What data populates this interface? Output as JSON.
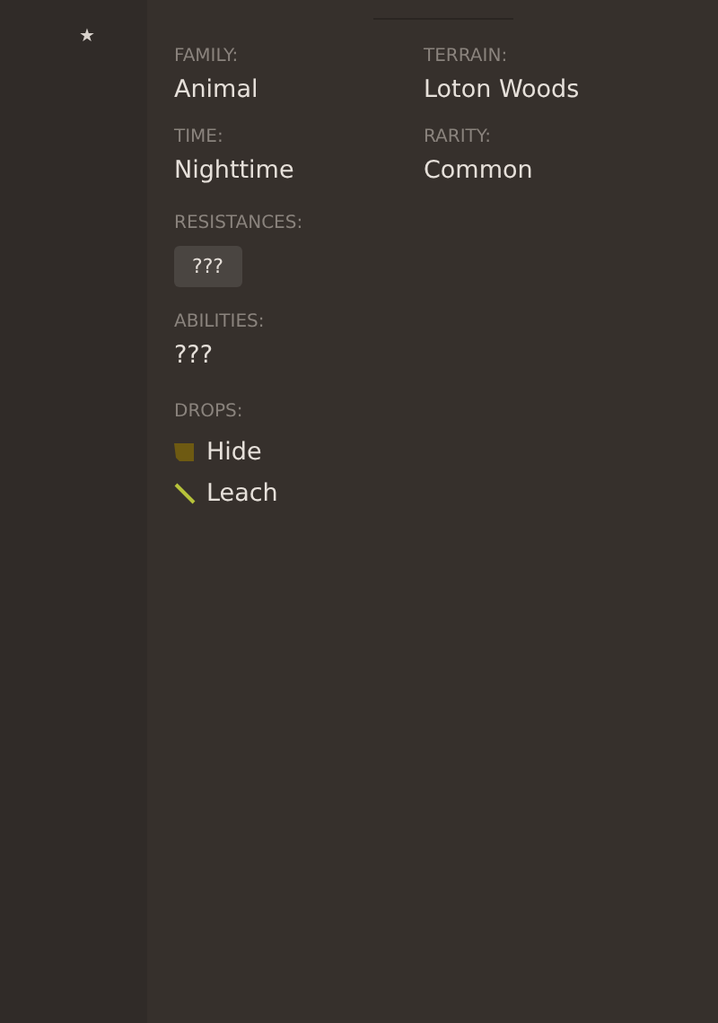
{
  "star": "★",
  "fields": [
    {
      "label": "FAMILY:",
      "value": "Animal"
    },
    {
      "label": "TERRAIN:",
      "value": "Loton Woods"
    },
    {
      "label": "TIME:",
      "value": "Nighttime"
    },
    {
      "label": "RARITY:",
      "value": "Common"
    }
  ],
  "resistances": {
    "label": "RESISTANCES:",
    "tags": [
      "???"
    ]
  },
  "abilities": {
    "label": "ABILITIES:",
    "value": "???"
  },
  "drops": {
    "label": "DROPS:",
    "items": [
      {
        "name": "Hide",
        "kind": "hide"
      },
      {
        "name": "Leach",
        "kind": "stick"
      }
    ]
  }
}
